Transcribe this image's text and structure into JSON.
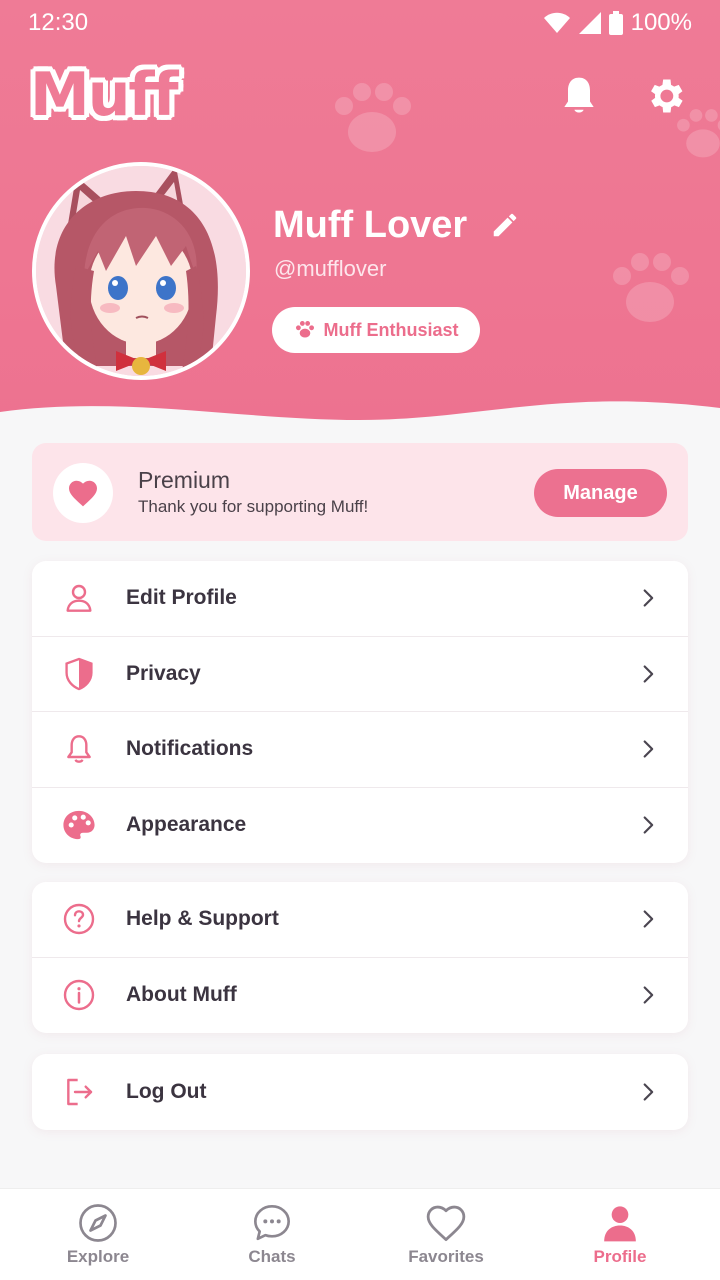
{
  "status_bar": {
    "time": "12:30",
    "battery": "100%"
  },
  "app": {
    "logo_text": "Muff"
  },
  "profile": {
    "name": "Muff Lover",
    "handle": "@mufflover",
    "badge": "Muff Enthusiast"
  },
  "premium": {
    "title": "Premium",
    "subtitle": "Thank you for supporting Muff!",
    "button": "Manage"
  },
  "menu_groups": [
    [
      {
        "label": "Edit Profile",
        "icon": "user-icon"
      },
      {
        "label": "Privacy",
        "icon": "shield-icon"
      },
      {
        "label": "Notifications",
        "icon": "bell-icon"
      },
      {
        "label": "Appearance",
        "icon": "palette-icon"
      }
    ],
    [
      {
        "label": "Help & Support",
        "icon": "help-icon"
      },
      {
        "label": "About Muff",
        "icon": "info-icon"
      }
    ],
    [
      {
        "label": "Log Out",
        "icon": "logout-icon"
      }
    ]
  ],
  "bottom_nav": [
    {
      "label": "Explore",
      "icon": "compass-icon",
      "active": false
    },
    {
      "label": "Chats",
      "icon": "chat-icon",
      "active": false
    },
    {
      "label": "Favorites",
      "icon": "heart-icon",
      "active": false
    },
    {
      "label": "Profile",
      "icon": "profile-icon",
      "active": true
    }
  ],
  "colors": {
    "accent": "#ec7190",
    "header": "#ef7b96",
    "premium_bg": "#fde4ea"
  }
}
